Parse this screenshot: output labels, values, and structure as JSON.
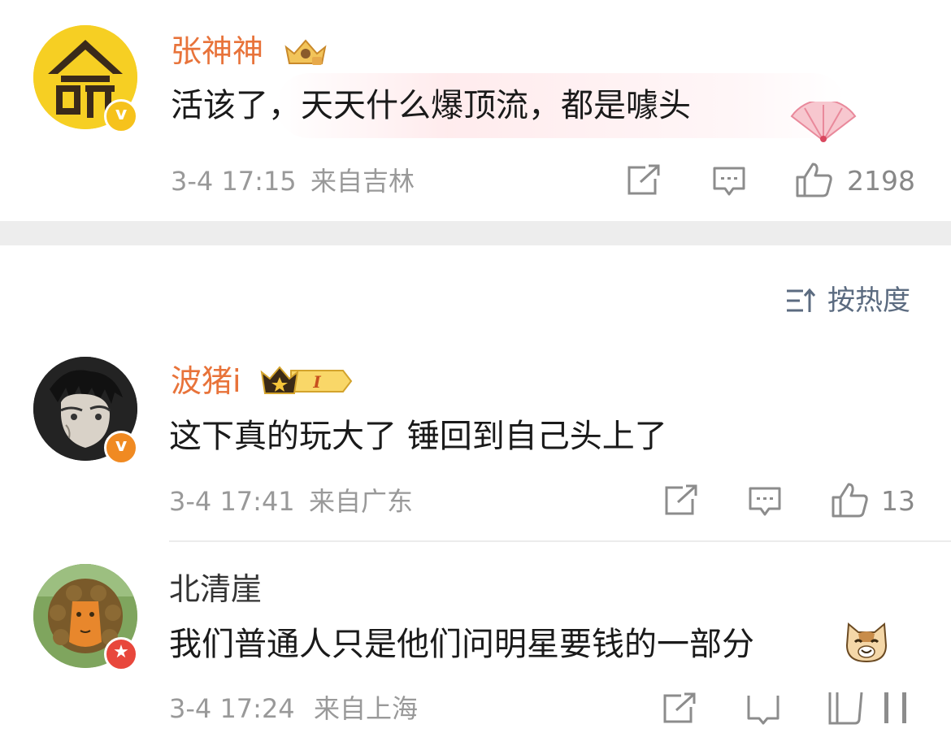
{
  "comments": [
    {
      "username": "张神神",
      "text": "活该了，天天什么爆顶流，都是噱头",
      "time": "3-4 17:15",
      "location": "来自吉林",
      "likes": "2198",
      "badge_icon": "crown-badge-icon",
      "avatar_icon": "avatar-ming-character-icon"
    },
    {
      "username": "波猪i",
      "text": "这下真的玩大了 锤回到自己头上了",
      "time": "3-4 17:41",
      "location": "来自广东",
      "likes": "13",
      "vip_level": "I",
      "badge_icon": "vip-crown-badge-icon",
      "avatar_icon": "avatar-anime-character-icon"
    },
    {
      "username": "北清崖",
      "text": "我们普通人只是他们问明星要钱的一部分",
      "time": "3-4 17:24",
      "location": "来自上海",
      "avatar_icon": "avatar-lion-sculpture-icon",
      "emoji_icon": "cat-face-emoji-icon"
    }
  ],
  "sort": {
    "label": "按热度"
  },
  "colors": {
    "vip_name": "#e8733a",
    "meta": "#999999",
    "sort": "#5b6b80"
  }
}
